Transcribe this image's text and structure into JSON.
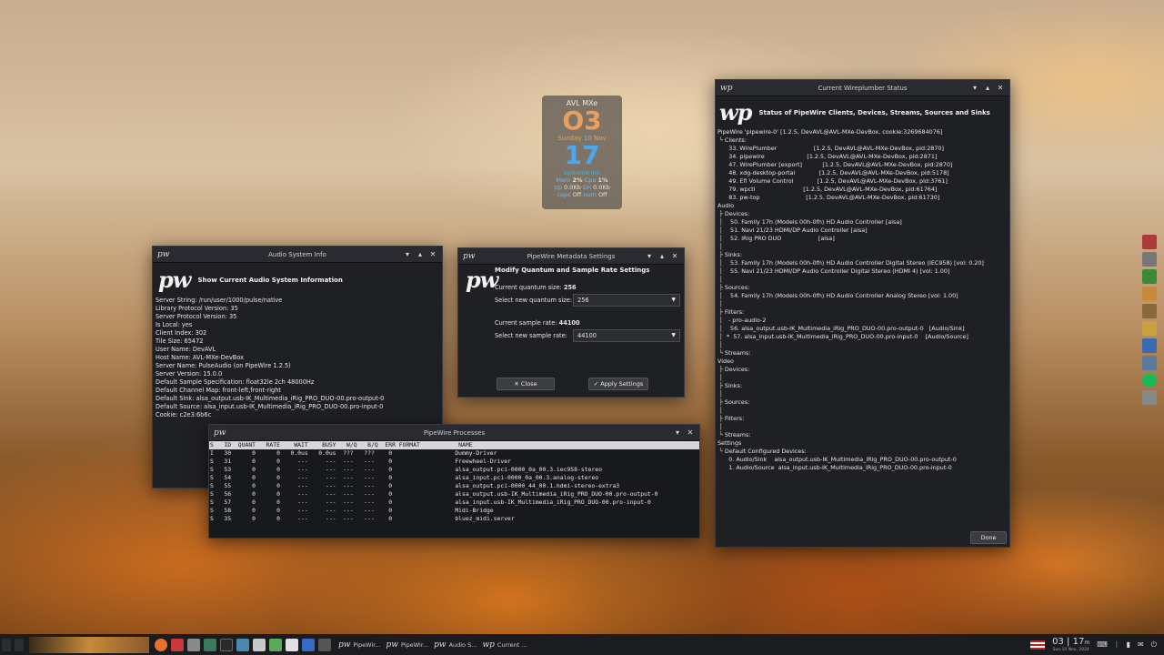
{
  "clock": {
    "host": "AVL MXe",
    "hour": "O3",
    "day": "Sunday",
    "date": "10",
    "month": "Nov",
    "minute": "17",
    "status": "systemd init",
    "mem_label": "Mem",
    "mem_value": "2%",
    "cpu_label": "Cpu",
    "cpu_value": "1%",
    "up_label": "Up",
    "up_value": "0.0Kb",
    "dn_label": "Dn",
    "dn_value": "0.0Kb",
    "caps_label": "caps",
    "caps_value": "Off",
    "num_label": "num",
    "num_value": "Off"
  },
  "audio_info": {
    "title": "Audio System Info",
    "logo": "pw",
    "header": "Show Current Audio System Information",
    "lines": [
      "Server String: /run/user/1000/pulse/native",
      "Library Protocol Version: 35",
      "Server Protocol Version: 35",
      "Is Local: yes",
      "Client Index: 302",
      "Tile Size: 65472",
      "User Name: DevAVL",
      "Host Name: AVL-MXe-DevBox",
      "Server Name: PulseAudio (on PipeWire 1.2.5)",
      "Server Version: 15.0.0",
      "Default Sample Specification: float32le 2ch 48000Hz",
      "Default Channel Map: front-left,front-right",
      "Default Sink: alsa_output.usb-IK_Multimedia_iRig_PRO_DUO-00.pro-output-0",
      "Default Source: alsa_input.usb-IK_Multimedia_iRig_PRO_DUO-00.pro-input-0",
      "Cookie: c2e3:6b6c"
    ]
  },
  "metadata": {
    "title": "PipeWire Metadata Settings",
    "logo": "pw",
    "header": "Modify Quantum and Sample Rate Settings",
    "quantum_label": "Current quantum size:",
    "quantum_value": "256",
    "new_quantum_label": "Select new quantum size:",
    "new_quantum_value": "256",
    "rate_label": "Current sample rate:",
    "rate_value": "44100",
    "new_rate_label": "Select new sample rate:",
    "new_rate_value": "44100",
    "close_label": "✕ Close",
    "apply_label": "✓ Apply Settings"
  },
  "processes": {
    "title": "PipeWire Processes",
    "logo": "pw",
    "header": "S   ID  QUANT   RATE    WAIT    BUSY   W/Q   B/Q  ERR FORMAT           NAME",
    "rows": [
      "I   30      0      0   0.0us   0.0us  ???   ???    0                  Dummy-Driver",
      "S   31      0      0     ---     ---  ---   ---    0                  Freewheel-Driver",
      "S   53      0      0     ---     ---  ---   ---    0                  alsa_output.pci-0000_0a_00.3.iec958-stereo",
      "S   54      0      0     ---     ---  ---   ---    0                  alsa_input.pci-0000_0a_00.3.analog-stereo",
      "S   55      0      0     ---     ---  ---   ---    0                  alsa_output.pci-0000_44_00.1.hdmi-stereo-extra3",
      "S   56      0      0     ---     ---  ---   ---    0                  alsa_output.usb-IK_Multimedia_iRig_PRO_DUO-00.pro-output-0",
      "S   57      0      0     ---     ---  ---   ---    0                  alsa_input.usb-IK_Multimedia_iRig_PRO_DUO-00.pro-input-0",
      "S   58      0      0     ---     ---  ---   ---    0                  Midi-Bridge",
      "S   35      0      0     ---     ---  ---   ---    0                  bluez_midi.server"
    ]
  },
  "wireplumber": {
    "title": "Current Wireplumber Status",
    "logo": "wp",
    "header": "Status of PipeWire Clients, Devices, Streams, Sources and Sinks",
    "lines": [
      "PipeWire 'pipewire-0' [1.2.5, DevAVL@AVL-MXe-DevBox, cookie:3269684076]",
      " └ Clients:",
      "      33. WirePlumber                    [1.2.5, DevAVL@AVL-MXe-DevBox, pid:2870]",
      "      34. pipewire                       [1.2.5, DevAVL@AVL-MXe-DevBox, pid:2871]",
      "      47. WirePlumber [export]           [1.2.5, DevAVL@AVL-MXe-DevBox, pid:2870]",
      "      48. xdg-desktop-portal             [1.2.5, DevAVL@AVL-MXe-DevBox, pid:5178]",
      "      49. Efl Volume Control             [1.2.5, DevAVL@AVL-MXe-DevBox, pid:3761]",
      "      79. wpctl                          [1.2.5, DevAVL@AVL-MXe-DevBox, pid:61764]",
      "      83. pw-top                         [1.2.5, DevAVL@AVL-MXe-DevBox, pid:61730]",
      "",
      "Audio",
      " ├ Devices:",
      " │    50. Family 17h (Models 00h-0fh) HD Audio Controller [alsa]",
      " │    51. Navi 21/23 HDMI/DP Audio Controller [alsa]",
      " │    52. iRig PRO DUO                    [alsa]",
      " │",
      " ├ Sinks:",
      " │    53. Family 17h (Models 00h-0fh) HD Audio Controller Digital Stereo (IEC958) [vol: 0.20]",
      " │    55. Navi 21/23 HDMI/DP Audio Controller Digital Stereo (HDMI 4) [vol: 1.00]",
      " │",
      " ├ Sources:",
      " │    54. Family 17h (Models 00h-0fh) HD Audio Controller Analog Stereo [vol: 1.00]",
      " │",
      " ├ Filters:",
      " │   - pro-audio-2",
      " │    56. alsa_output.usb-IK_Multimedia_iRig_PRO_DUO-00.pro-output-0   [Audio/Sink]",
      " │  *  57. alsa_input.usb-IK_Multimedia_iRig_PRO_DUO-00.pro-input-0    [Audio/Source]",
      " │",
      " └ Streams:",
      "",
      "Video",
      " ├ Devices:",
      " │",
      " ├ Sinks:",
      " │",
      " ├ Sources:",
      " │",
      " ├ Filters:",
      " │",
      " └ Streams:",
      "",
      "Settings",
      " └ Default Configured Devices:",
      "      0. Audio/Sink    alsa_output.usb-IK_Multimedia_iRig_PRO_DUO-00.pro-output-0",
      "      1. Audio/Source  alsa_input.usb-IK_Multimedia_iRig_PRO_DUO-00.pro-input-0"
    ],
    "done_label": "Done"
  },
  "taskbar": {
    "tasks": [
      {
        "logo": "pw",
        "label": "PipeWir..."
      },
      {
        "logo": "pw",
        "label": "PipeWir..."
      },
      {
        "logo": "pw",
        "label": "Audio S..."
      },
      {
        "logo": "wp",
        "label": "Current ..."
      }
    ],
    "clock": "03 | 17",
    "clock_suffix": "m",
    "date": "Sun,10 Nov, 2024"
  },
  "window_controls": {
    "minimize": "▾",
    "maximize": "▴",
    "close": "✕"
  }
}
